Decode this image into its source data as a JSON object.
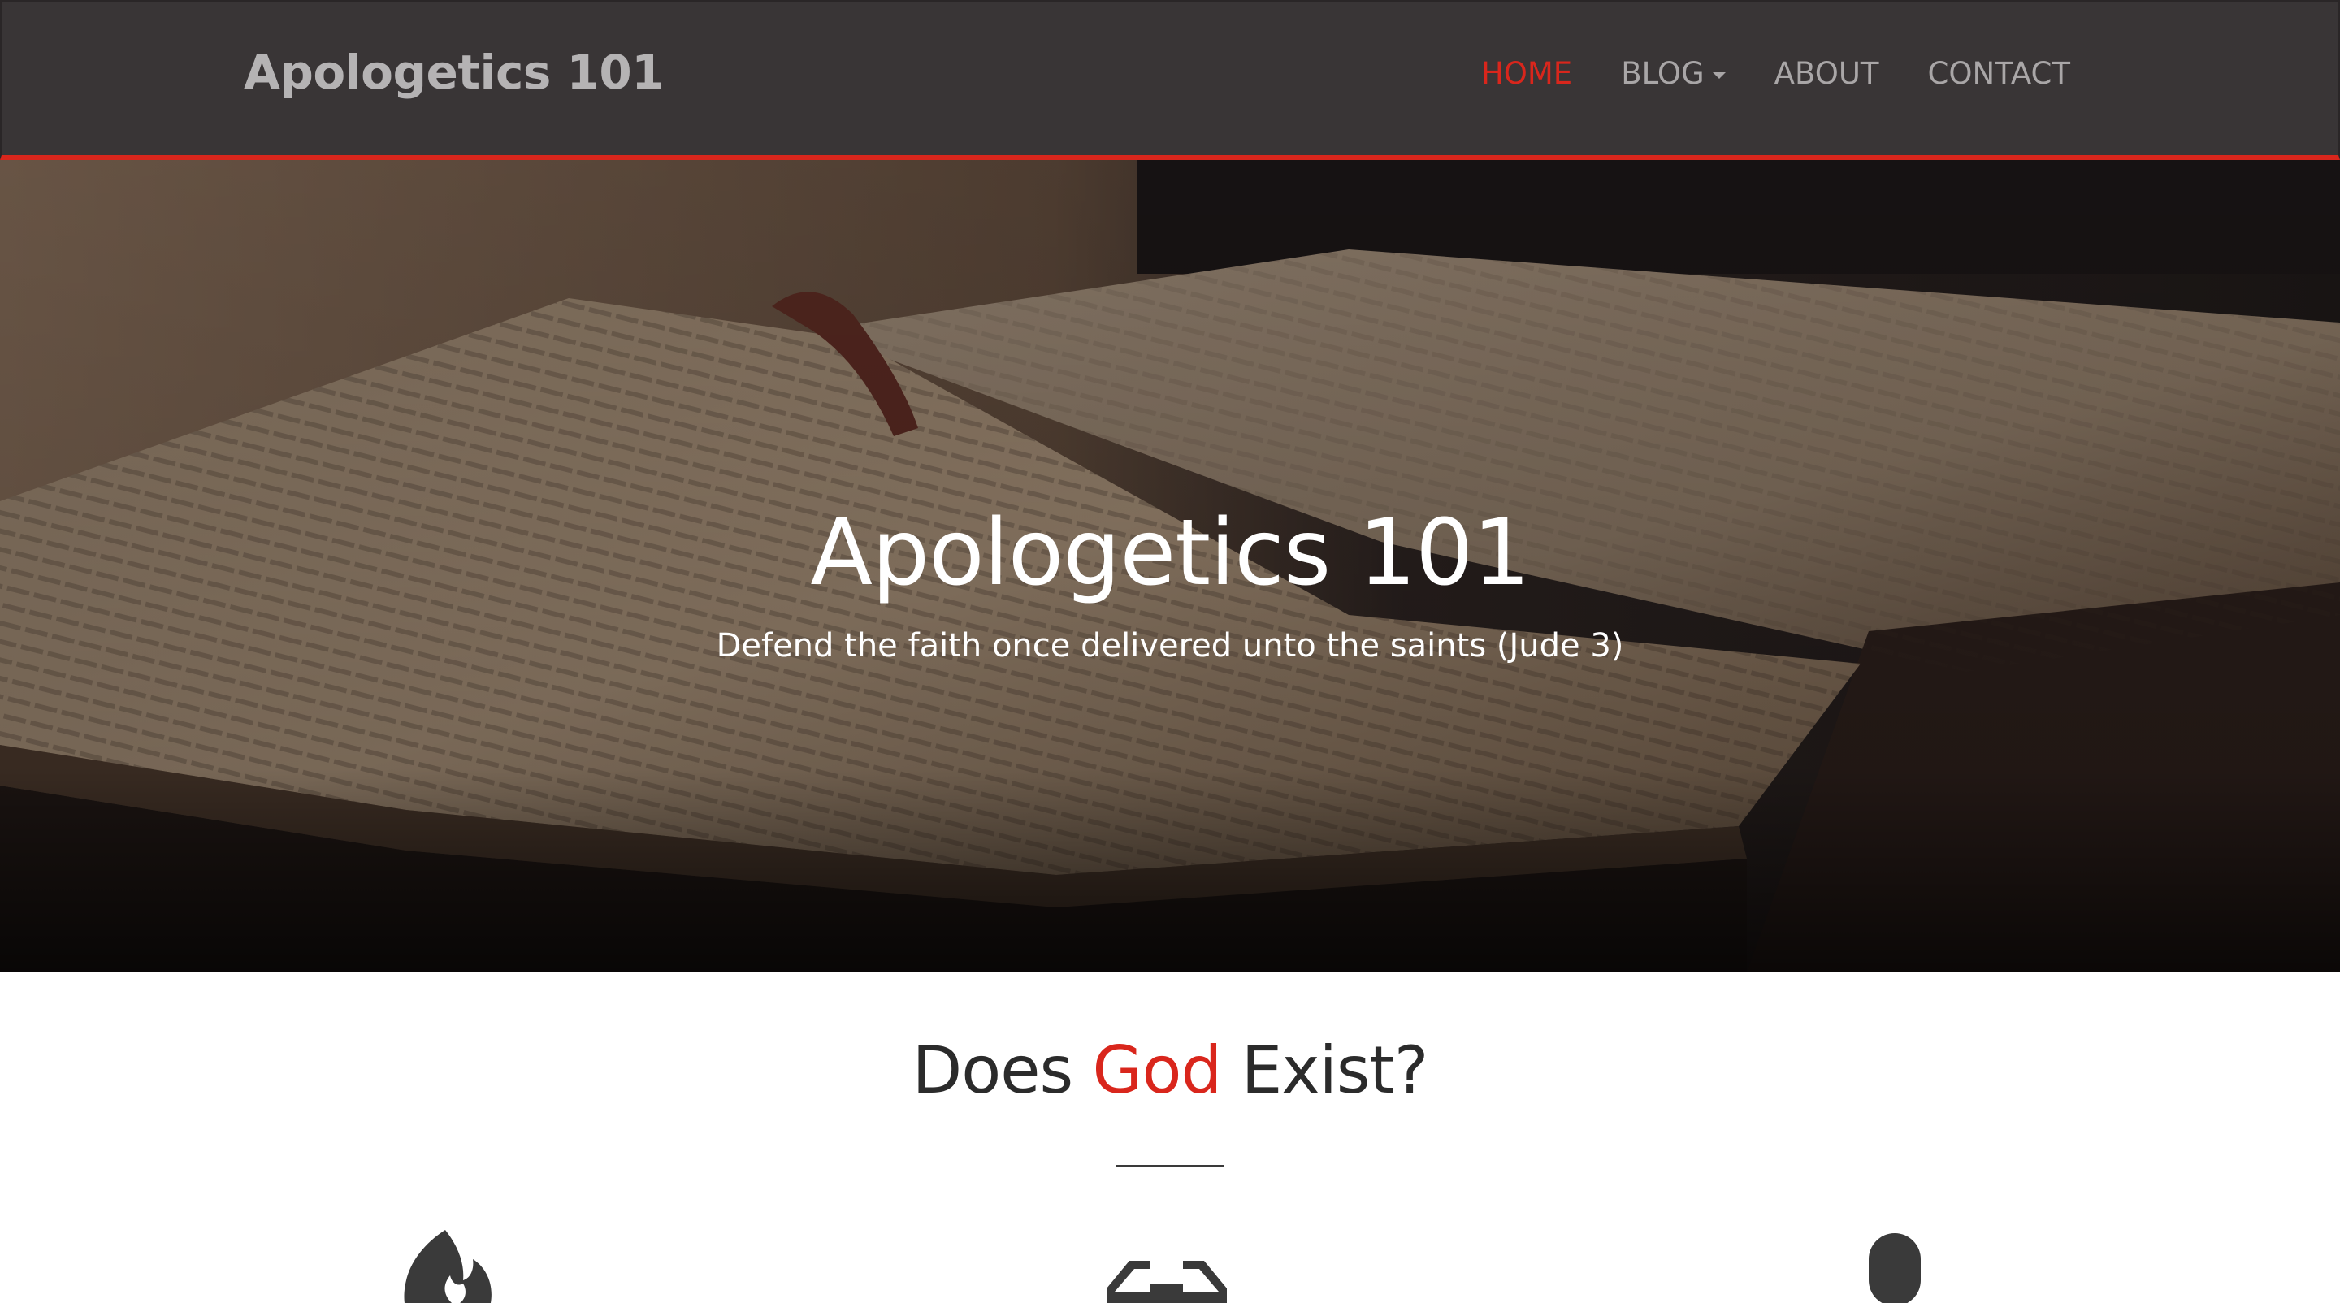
{
  "navbar": {
    "brand": "Apologetics 101",
    "items": [
      {
        "label": "HOME",
        "active": true
      },
      {
        "label": "BLOG",
        "dropdown": true
      },
      {
        "label": "ABOUT"
      },
      {
        "label": "CONTACT"
      }
    ]
  },
  "hero": {
    "title": "Apologetics 101",
    "subtitle": "Defend the faith once delivered unto the saints (Jude 3)"
  },
  "section": {
    "title_before": "Does ",
    "title_accent": "God",
    "title_after": " Exist?"
  },
  "features": [
    {
      "icon": "fire-icon"
    },
    {
      "icon": "glasses-icon"
    },
    {
      "icon": "microphone-icon"
    }
  ],
  "colors": {
    "accent": "#d9261c",
    "navbar_bg": "#393536",
    "icon": "#3a3a3a"
  }
}
